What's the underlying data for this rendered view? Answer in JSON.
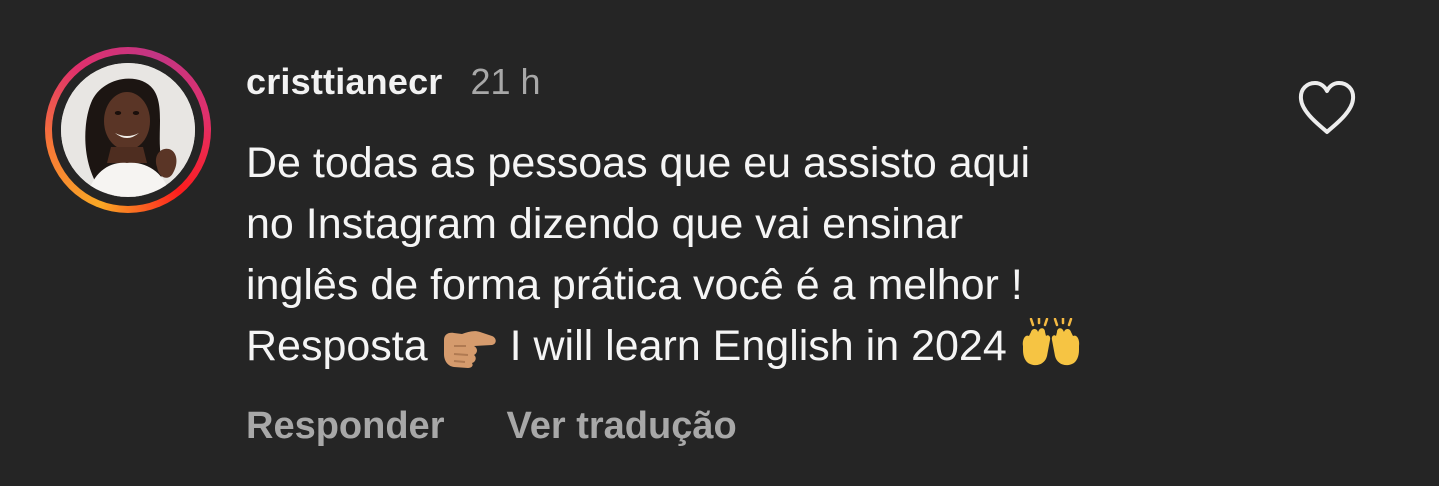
{
  "comment": {
    "username": "cristtianecr",
    "time": "21 h",
    "text_lines": [
      "De todas as pessoas que eu assisto aqui",
      "no Instagram dizendo que vai ensinar",
      "inglês de forma prática você é a melhor !"
    ],
    "last_line": {
      "prefix": "Resposta ",
      "emoji_1": "pointing-right-hand-emoji",
      "middle": " I will learn English in 2024",
      "emoji_2": "raising-hands-emoji"
    },
    "actions": {
      "reply": "Responder",
      "translate": "Ver tradução"
    },
    "icons": {
      "like": "heart-outline-icon",
      "avatar": "profile-photo"
    },
    "colors": {
      "background": "#252525",
      "primary_text": "#f5f5f5",
      "secondary_text": "#a8a8a8",
      "story_ring": [
        "#f9a825",
        "#e1306c",
        "#c13584"
      ]
    }
  }
}
